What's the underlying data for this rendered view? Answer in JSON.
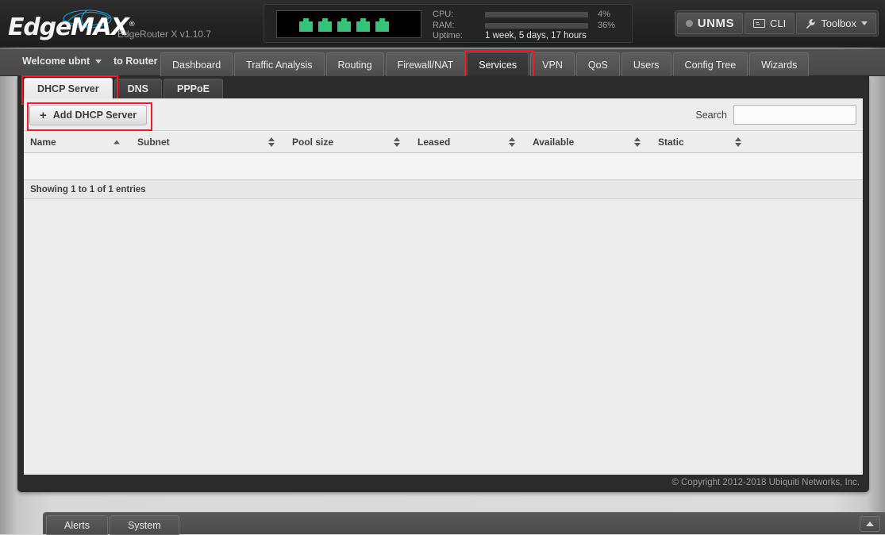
{
  "header": {
    "brand_edge": "Edge",
    "brand_max": "MAX",
    "brand_reg": "®",
    "model": "EdgeRouter X v1.10.7",
    "status": {
      "ports": [
        "port-1",
        "port-2",
        "port-3",
        "port-4",
        "port-5"
      ],
      "cpu_label": "CPU:",
      "cpu_value": "4%",
      "cpu_percent": 4,
      "ram_label": "RAM:",
      "ram_value": "36%",
      "ram_percent": 36,
      "uptime_label": "Uptime:",
      "uptime_value": "1 week, 5 days, 17 hours",
      "meter_color": "#2e8fd4",
      "port_color": "#36c278"
    },
    "actions": {
      "unms_label": "UNMS",
      "unms_sup": "™",
      "cli_label": "CLI",
      "toolbox_label": "Toolbox"
    }
  },
  "nav": {
    "welcome": "Welcome ubnt",
    "to_router": "to Router",
    "tabs": [
      {
        "label": "Dashboard",
        "active": false,
        "highlighted": false
      },
      {
        "label": "Traffic Analysis",
        "active": false,
        "highlighted": false
      },
      {
        "label": "Routing",
        "active": false,
        "highlighted": false
      },
      {
        "label": "Firewall/NAT",
        "active": false,
        "highlighted": false
      },
      {
        "label": "Services",
        "active": true,
        "highlighted": true
      },
      {
        "label": "VPN",
        "active": false,
        "highlighted": false
      },
      {
        "label": "QoS",
        "active": false,
        "highlighted": false
      },
      {
        "label": "Users",
        "active": false,
        "highlighted": false
      },
      {
        "label": "Config Tree",
        "active": false,
        "highlighted": false
      },
      {
        "label": "Wizards",
        "active": false,
        "highlighted": false
      }
    ],
    "highlight_color": "#ee1c25"
  },
  "subtabs": [
    {
      "label": "DHCP Server",
      "active": true,
      "highlighted": true
    },
    {
      "label": "DNS",
      "active": false,
      "highlighted": false
    },
    {
      "label": "PPPoE",
      "active": false,
      "highlighted": false
    }
  ],
  "toolbar": {
    "add_button_icon": "+",
    "add_button_label": "Add DHCP Server",
    "search_label": "Search",
    "search_value": "",
    "search_placeholder": ""
  },
  "table": {
    "columns": [
      {
        "label": "Name",
        "sort": "asc"
      },
      {
        "label": "Subnet",
        "sort": "none"
      },
      {
        "label": "Pool size",
        "sort": "none"
      },
      {
        "label": "Leased",
        "sort": "none"
      },
      {
        "label": "Available",
        "sort": "none"
      },
      {
        "label": "Static",
        "sort": "none"
      }
    ],
    "rows": [],
    "info": "Showing 1 to 1 of 1 entries"
  },
  "footer": {
    "copyright": "© Copyright 2012-2018 Ubiquiti Networks, Inc."
  },
  "bottombar": {
    "buttons": [
      {
        "label": "Alerts"
      },
      {
        "label": "System"
      }
    ],
    "scroll_top_icon": "chevron-up-icon"
  }
}
